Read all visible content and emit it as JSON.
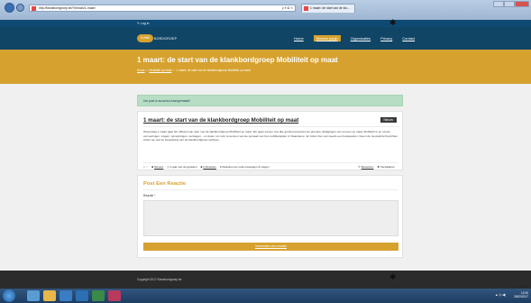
{
  "browser": {
    "url": "http://klankbordgroep.be/?nieuws/1-maart",
    "tab_title": "1 maart: de start van de klo...",
    "address_controls": "ρ ▾ ⊠ ↻"
  },
  "site": {
    "login": "✎ Log in",
    "logo_circle": "KLANK",
    "logo_word": "BORDGROEP",
    "menu": [
      {
        "label": "Home",
        "active": false
      },
      {
        "label": "Nieuws pagin",
        "active": true
      },
      {
        "label": "Organisaties",
        "active": false
      },
      {
        "label": "Privacy",
        "active": false
      },
      {
        "label": "Contact",
        "active": false
      }
    ]
  },
  "page": {
    "title": "1 maart: de start van de klankbordgroep Mobiliteit op maat",
    "breadcrumb": {
      "home": "Home",
      "parent": "Mobiliteit op maat",
      "sep": "/",
      "current": "1 maart: de start van de klankbordgroep Mobiliteit op maat"
    }
  },
  "alert": "Uw post is succesvol aangemaakt!",
  "post": {
    "title": "1 maart: de start van de klankbordgroep Mobiliteit op maat",
    "badge": "Nieuws",
    "body": "Woensdag 1 maart gaat het officieel van start met de klankbordgroep Mobiliteit op maat. We gaan samen met alle geïnteresseerden de grootste uitdagingen van vervoer op maat. Mobiliteit is en omvat vervoeringen, vragen, opmerkingen, verslagen... en delen om ruim te kennen van de opmaak van het mobiliteitsplan in Vlaanderen. Er zullen hier ook steeds een bestaanden. Neem de nieuwsbrief berichten zullen we ook de bespreking van de klankbordgroep verfijnen.",
    "meta": {
      "votes": "0 ☆",
      "category": "Nieuws",
      "author": "1 jaar van de geleden",
      "comments": "0 Reacties",
      "notify": "Reacties per mail ontvangen & volgen",
      "edit": "Bewerken",
      "delete": "Verwijderen"
    }
  },
  "reply": {
    "heading": "Post Een Reactie",
    "label": "Reactie",
    "required": "*",
    "placeholder": "",
    "submit": "Verzenden een reactie"
  },
  "footer": {
    "copyright": "Copyright 2017 Klankbordgroep.be"
  },
  "zoom": "% 80%",
  "taskbar": {
    "clock_time": "12:00",
    "clock_date": "28/02/2017",
    "tray": "▲ ◷ ◀)"
  },
  "colors": {
    "accent": "#d6a12e",
    "nav": "#114566",
    "topbar": "#0e4a73",
    "footer": "#2b2b2b",
    "alert_bg": "#b7dec4"
  }
}
